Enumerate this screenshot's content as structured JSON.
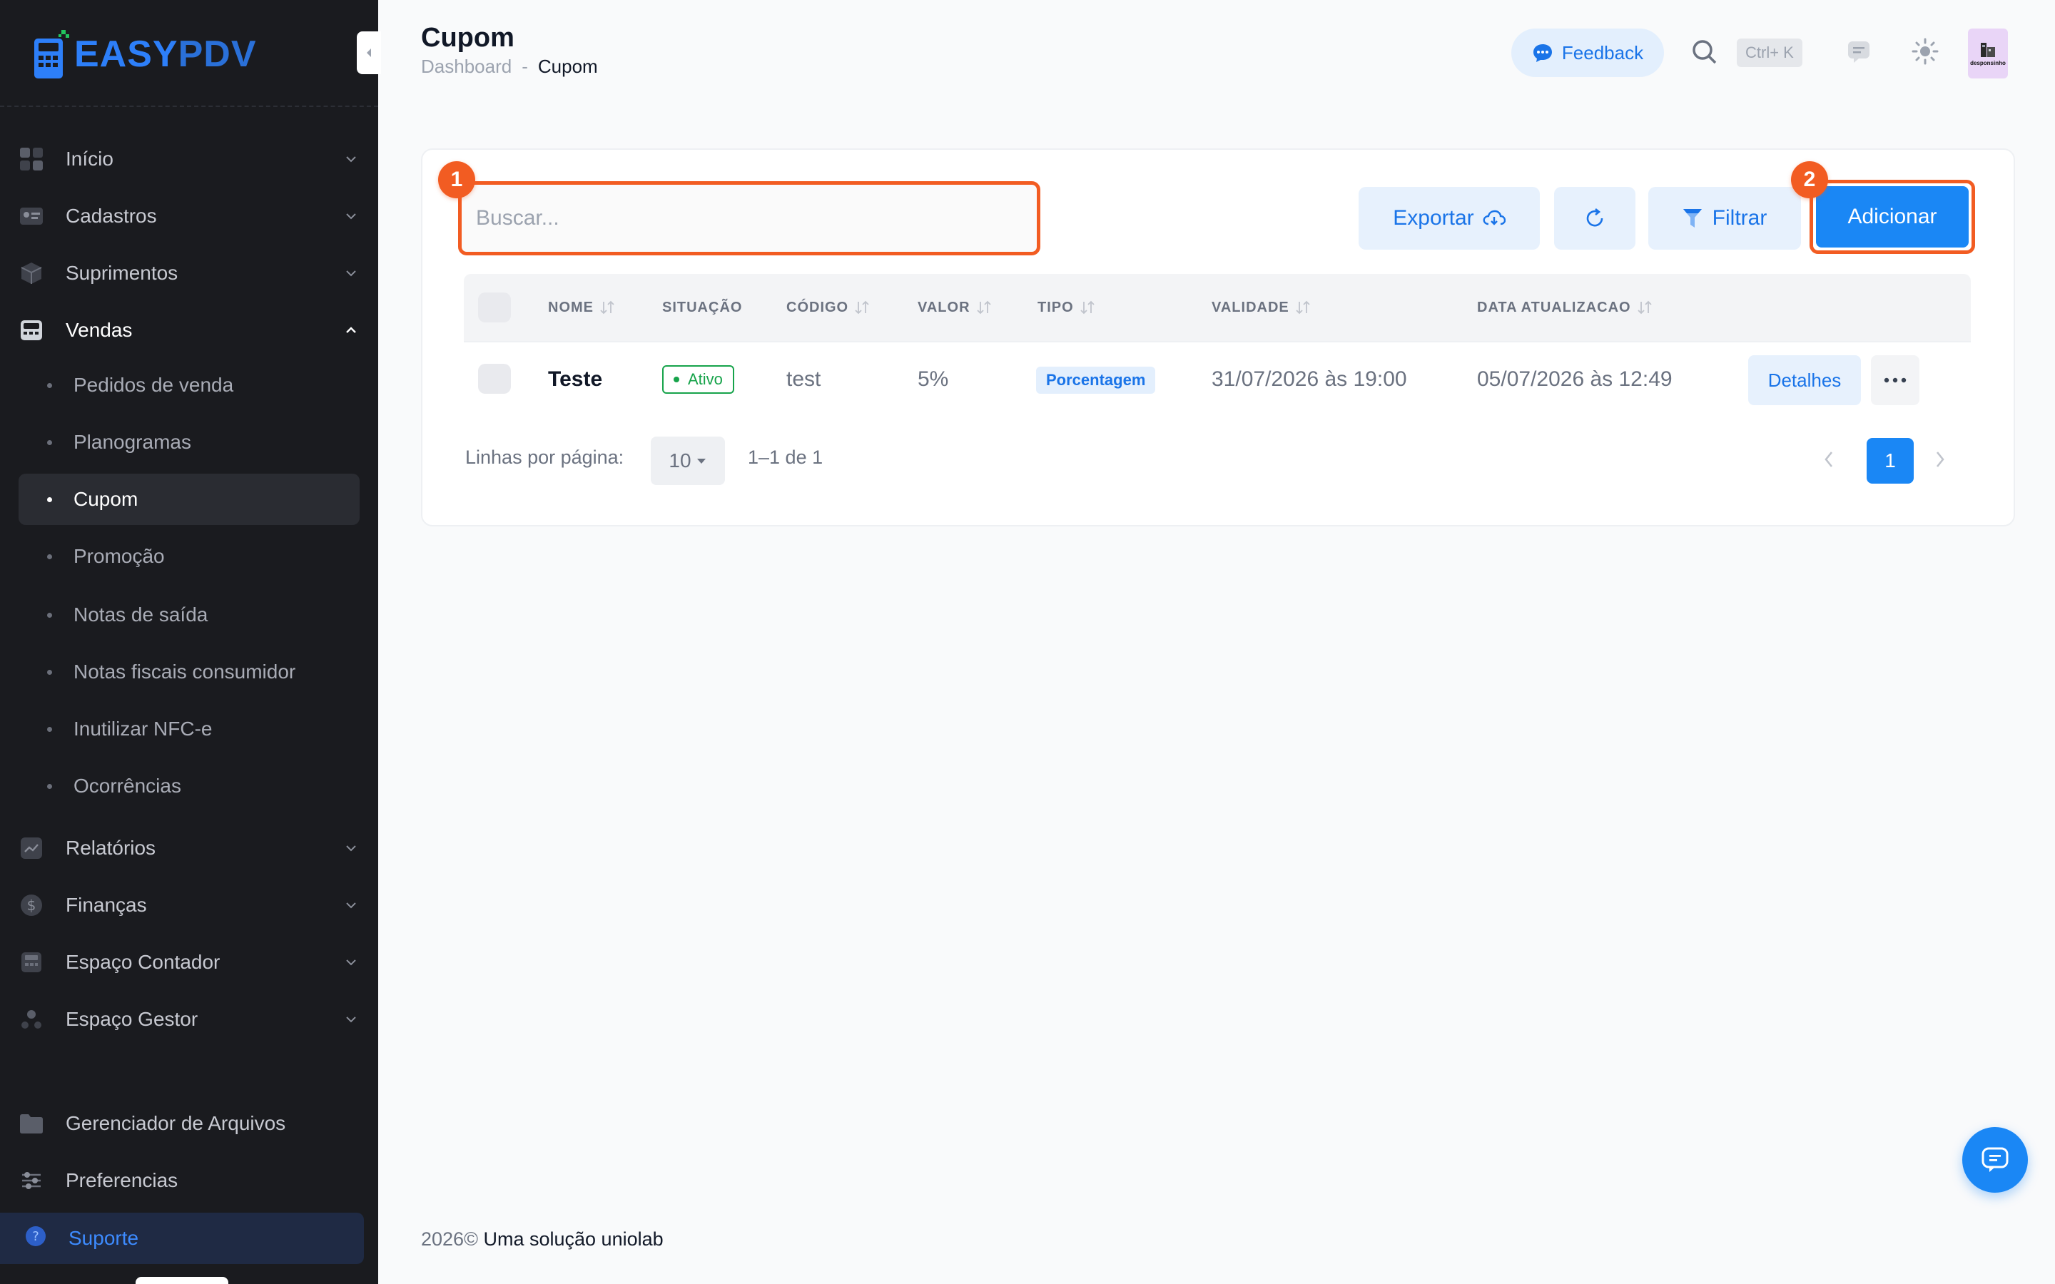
{
  "brand": {
    "logo_easy": "EASY",
    "logo_pdv": "PDV",
    "accent_color": "#1a87f5",
    "highlight_color": "#f25c22"
  },
  "sidebar": {
    "groups": [
      {
        "label": "Início",
        "icon": "grid-icon"
      },
      {
        "label": "Cadastros",
        "icon": "id-card-icon"
      },
      {
        "label": "Suprimentos",
        "icon": "box-icon"
      },
      {
        "label": "Vendas",
        "icon": "register-icon",
        "expanded": true
      }
    ],
    "vendas_items": [
      {
        "label": "Pedidos de venda"
      },
      {
        "label": "Planogramas"
      },
      {
        "label": "Cupom",
        "active": true
      },
      {
        "label": "Promoção"
      },
      {
        "label": "Notas de saída"
      },
      {
        "label": "Notas fiscais consumidor"
      },
      {
        "label": "Inutilizar NFC-e"
      },
      {
        "label": "Ocorrências"
      }
    ],
    "groups_after": [
      {
        "label": "Relatórios",
        "icon": "chart-icon"
      },
      {
        "label": "Finanças",
        "icon": "dollar-icon"
      },
      {
        "label": "Espaço Contador",
        "icon": "calculator-icon"
      },
      {
        "label": "Espaço Gestor",
        "icon": "manager-icon"
      }
    ],
    "bottom": [
      {
        "label": "Gerenciador de Arquivos",
        "icon": "folder-icon"
      },
      {
        "label": "Preferencias",
        "icon": "sliders-icon"
      }
    ],
    "support": {
      "label": "Suporte",
      "icon": "help-icon"
    }
  },
  "header": {
    "title": "Cupom",
    "breadcrumb": [
      "Dashboard",
      "-",
      "Cupom"
    ],
    "feedback_label": "Feedback",
    "shortcut": "Ctrl+ K",
    "avatar_text": "desponsinho"
  },
  "toolbar": {
    "search_placeholder": "Buscar...",
    "search_value": "",
    "export_label": "Exportar",
    "filter_label": "Filtrar",
    "add_label": "Adicionar",
    "markers": [
      "1",
      "2"
    ]
  },
  "table": {
    "columns": [
      "NOME",
      "SITUAÇÃO",
      "CÓDIGO",
      "VALOR",
      "TIPO",
      "VALIDADE",
      "DATA ATUALIZACAO"
    ],
    "rows": [
      {
        "nome": "Teste",
        "situacao": "Ativo",
        "codigo": "test",
        "valor": "5%",
        "tipo": "Porcentagem",
        "validade": "31/07/2026 às 19:00",
        "atualizacao": "05/07/2026 às 12:49",
        "details_label": "Detalhes"
      }
    ]
  },
  "pagination": {
    "rows_label": "Linhas por página:",
    "rows_per_page": "10",
    "range": "1–1 de 1",
    "current_page": "1"
  },
  "footer": {
    "year": "2026©",
    "text": "Uma solução uniolab"
  }
}
